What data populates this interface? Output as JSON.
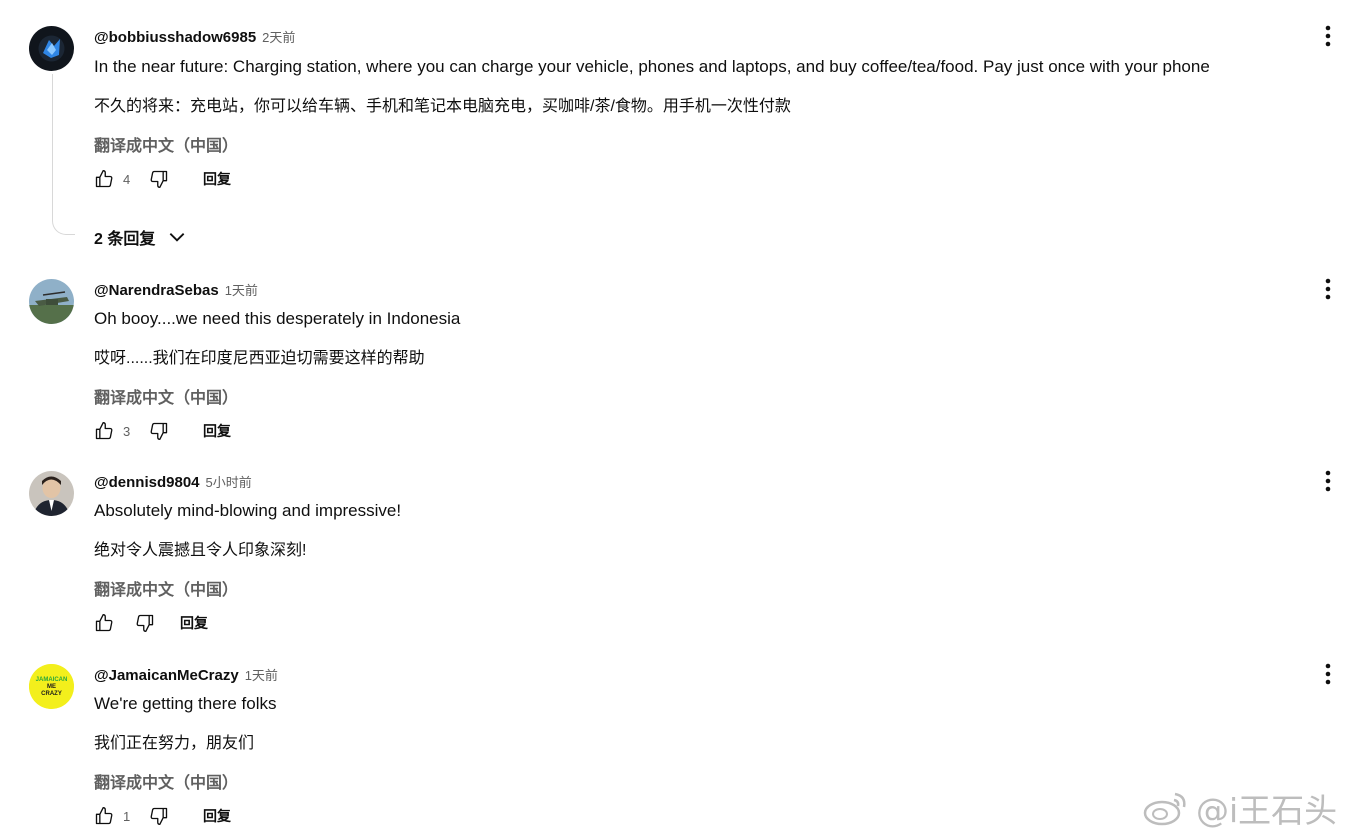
{
  "comments": [
    {
      "author": "@bobbiusshadow6985",
      "time": "2天前",
      "text_en": "In the near future: Charging station, where you can charge your vehicle, phones and laptops, and buy coffee/tea/food. Pay just once with your phone",
      "text_zh": "不久的将来：充电站，你可以给车辆、手机和笔记本电脑充电，买咖啡/茶/食物。用手机一次性付款",
      "translate_label": "翻译成中文（中国）",
      "likes": "4",
      "reply_label": "回复",
      "replies_label": "2 条回复"
    },
    {
      "author": "@NarendraSebas",
      "time": "1天前",
      "text_en": "Oh booy....we need this desperately in Indonesia",
      "text_zh": "哎呀......我们在印度尼西亚迫切需要这样的帮助",
      "translate_label": "翻译成中文（中国）",
      "likes": "3",
      "reply_label": "回复"
    },
    {
      "author": "@dennisd9804",
      "time": "5小时前",
      "text_en": "Absolutely mind-blowing and impressive!",
      "text_zh": "绝对令人震撼且令人印象深刻!",
      "translate_label": "翻译成中文（中国）",
      "likes": "",
      "reply_label": "回复"
    },
    {
      "author": "@JamaicanMeCrazy",
      "time": "1天前",
      "text_en": "We're getting there folks",
      "text_zh": "我们正在努力，朋友们",
      "translate_label": "翻译成中文（中国）",
      "likes": "1",
      "reply_label": "回复",
      "avatar_text": [
        "JAMAICAN",
        "ME",
        "CRAZY"
      ]
    }
  ],
  "watermark": "@i王石头",
  "colors": {
    "text_primary": "#0f0f0f",
    "text_secondary": "#606060",
    "avatar4_bg": "#f3ef1c",
    "watermark": "#bdbdbd"
  },
  "icons": [
    "thumb-up-icon",
    "thumb-down-icon",
    "more-vert-icon",
    "chevron-down-icon",
    "weibo-icon"
  ]
}
